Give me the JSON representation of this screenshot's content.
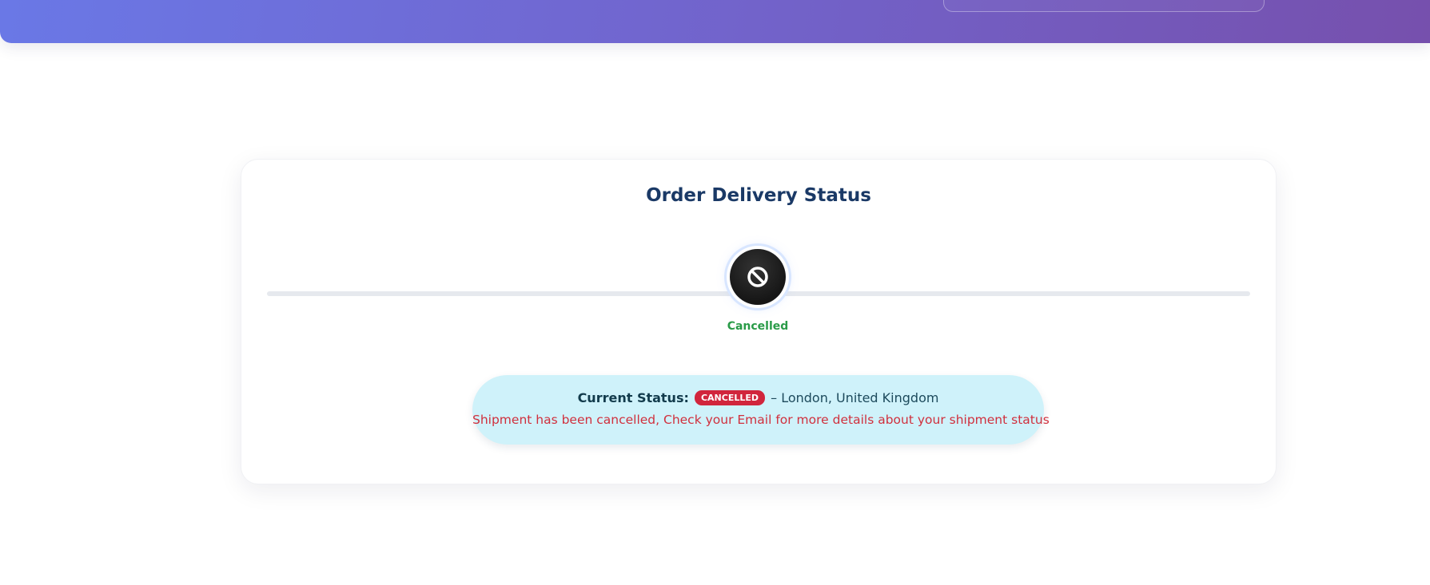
{
  "title": "Order Delivery Status",
  "step": {
    "label": "Cancelled",
    "icon": "ban-icon"
  },
  "status": {
    "prefix": "Current Status:",
    "badge": "CANCELLED",
    "location": "– London, United Kingdom",
    "message": "Shipment has been cancelled, Check your Email for more details about your shipment status"
  },
  "colors": {
    "header_gradient_start": "#6a78e6",
    "header_gradient_end": "#7650ad",
    "title": "#1a3966",
    "step_label": "#2a9b48",
    "badge": "#d1253c",
    "message": "#d0303d",
    "status_box": "#cff2fa"
  }
}
